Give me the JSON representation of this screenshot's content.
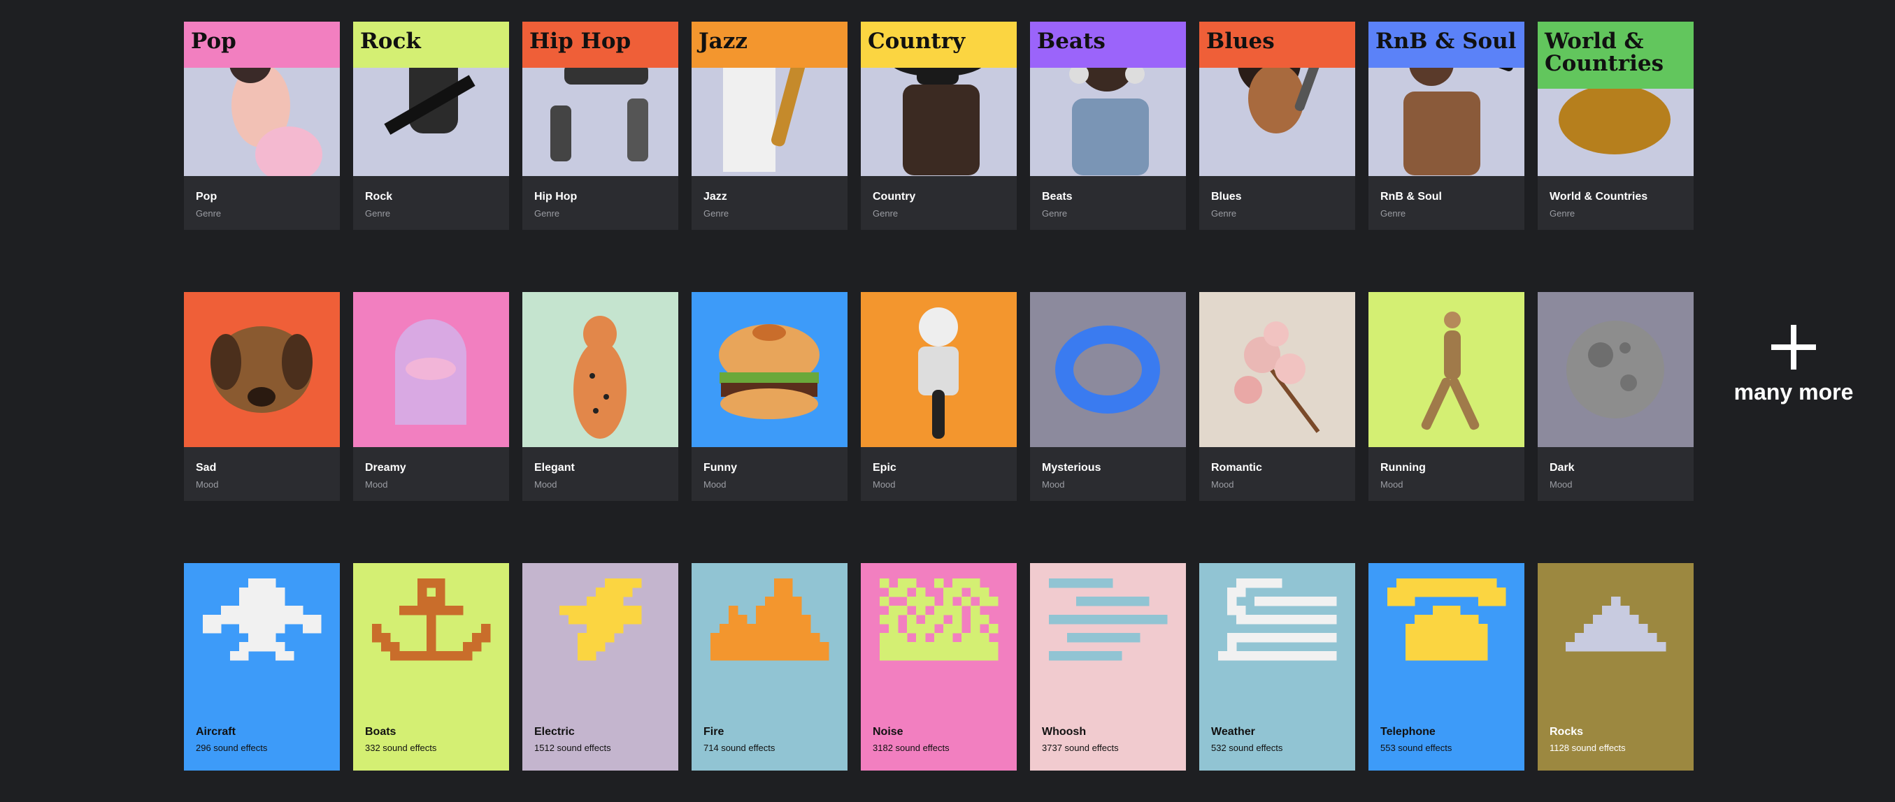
{
  "genres": [
    {
      "head": "Pop",
      "title": "Pop",
      "sub": "Genre",
      "color": "#f27fc0",
      "icon": "pop-singer-photo"
    },
    {
      "head": "Rock",
      "title": "Rock",
      "sub": "Genre",
      "color": "#d4ef73",
      "icon": "guitarist-photo"
    },
    {
      "head": "Hip Hop",
      "title": "Hip Hop",
      "sub": "Genre",
      "color": "#ef5f38",
      "icon": "breakdancer-photo"
    },
    {
      "head": "Jazz",
      "title": "Jazz",
      "sub": "Genre",
      "color": "#f3962e",
      "icon": "saxophonist-photo"
    },
    {
      "head": "Country",
      "title": "Country",
      "sub": "Genre",
      "color": "#fbd541",
      "icon": "cowboy-photo"
    },
    {
      "head": "Beats",
      "title": "Beats",
      "sub": "Genre",
      "color": "#9b64fa",
      "icon": "headphones-listener-photo"
    },
    {
      "head": "Blues",
      "title": "Blues",
      "sub": "Genre",
      "color": "#ef5f38",
      "icon": "blues-singer-photo"
    },
    {
      "head": "RnB & Soul",
      "title": "RnB & Soul",
      "sub": "Genre",
      "color": "#5b82f8",
      "icon": "soul-singer-photo"
    },
    {
      "head": "World & Countries",
      "title": "World & Countries",
      "sub": "Genre",
      "color": "#62c65d",
      "icon": "golden-statue-photo"
    }
  ],
  "moods": [
    {
      "title": "Sad",
      "sub": "Mood",
      "color": "#ef5f38",
      "icon": "puppy-photo"
    },
    {
      "title": "Dreamy",
      "sub": "Mood",
      "color": "#f27fc0",
      "icon": "cloud-arch-photo"
    },
    {
      "title": "Elegant",
      "sub": "Mood",
      "color": "#c5e4cf",
      "icon": "cheetah-figurine-photo"
    },
    {
      "title": "Funny",
      "sub": "Mood",
      "color": "#3d9bf9",
      "icon": "burger-photo"
    },
    {
      "title": "Epic",
      "sub": "Mood",
      "color": "#f3962e",
      "icon": "astronaut-motorcycle-photo"
    },
    {
      "title": "Mysterious",
      "sub": "Mood",
      "color": "#8c8a9d",
      "icon": "glass-ring-photo"
    },
    {
      "title": "Romantic",
      "sub": "Mood",
      "color": "#e2d8cc",
      "icon": "flower-branch-photo"
    },
    {
      "title": "Running",
      "sub": "Mood",
      "color": "#d4ef73",
      "icon": "wooden-mannequin-photo"
    },
    {
      "title": "Dark",
      "sub": "Mood",
      "color": "#8c8a9d",
      "icon": "moon-photo"
    }
  ],
  "sfx": [
    {
      "title": "Aircraft",
      "sub": "296 sound effects",
      "color": "#3d9bf9",
      "fg": "#f1f1f1",
      "icon": "airplane-icon"
    },
    {
      "title": "Boats",
      "sub": "332 sound effects",
      "color": "#d4ef73",
      "fg": "#c96d2b",
      "icon": "anchor-icon"
    },
    {
      "title": "Electric",
      "sub": "1512 sound effects",
      "color": "#c4b5ce",
      "fg": "#fbd541",
      "icon": "lightning-icon"
    },
    {
      "title": "Fire",
      "sub": "714 sound effects",
      "color": "#91c4d3",
      "fg": "#f3962e",
      "icon": "fire-icon"
    },
    {
      "title": "Noise",
      "sub": "3182 sound effects",
      "color": "#f27fc0",
      "fg": "#d4ef73",
      "icon": "noise-pixels-icon"
    },
    {
      "title": "Whoosh",
      "sub": "3737 sound effects",
      "color": "#f1cbcf",
      "fg": "#91c4d3",
      "icon": "whoosh-lines-icon"
    },
    {
      "title": "Weather",
      "sub": "532 sound effects",
      "color": "#91c4d3",
      "fg": "#f1f1f1",
      "icon": "wind-icon"
    },
    {
      "title": "Telephone",
      "sub": "553 sound effects",
      "color": "#3d9bf9",
      "fg": "#fbd541",
      "icon": "telephone-icon"
    },
    {
      "title": "Rocks",
      "sub": "1128 sound effects",
      "color": "#9c8840",
      "fg": "#c8cbe0",
      "icon": "rock-pile-icon"
    }
  ],
  "more": {
    "label": "many more",
    "icon": "plus-icon"
  }
}
